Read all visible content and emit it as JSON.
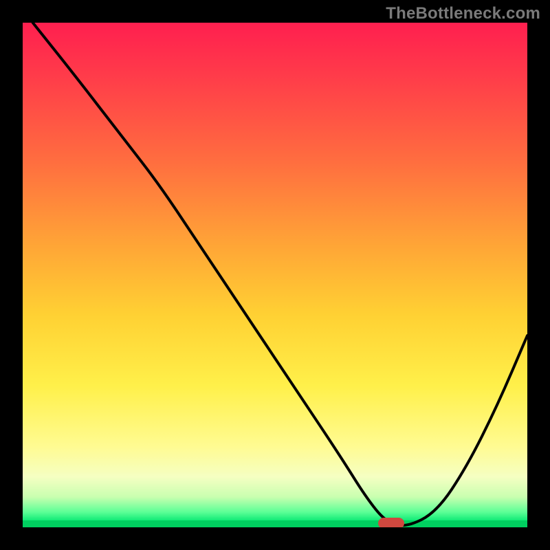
{
  "watermark": "TheBottleneck.com",
  "chart_data": {
    "type": "line",
    "title": "",
    "xlabel": "",
    "ylabel": "",
    "xlim": [
      0,
      100
    ],
    "ylim": [
      0,
      100
    ],
    "grid": false,
    "legend": false,
    "series": [
      {
        "name": "curve",
        "x": [
          2,
          10,
          20,
          27,
          35,
          45,
          55,
          63,
          68,
          72,
          76,
          82,
          88,
          94,
          100
        ],
        "y": [
          100,
          90,
          77,
          68,
          56,
          41,
          26,
          14,
          6,
          1,
          0,
          3,
          12,
          24,
          38
        ]
      }
    ],
    "marker": {
      "x": 73,
      "y": 0.8,
      "shape": "pill",
      "color": "#d0483f"
    },
    "gradient_stops": [
      {
        "pos": 0,
        "color": "#ff1f4f"
      },
      {
        "pos": 45,
        "color": "#ffa836"
      },
      {
        "pos": 72,
        "color": "#fff04a"
      },
      {
        "pos": 100,
        "color": "#00d060"
      }
    ]
  }
}
